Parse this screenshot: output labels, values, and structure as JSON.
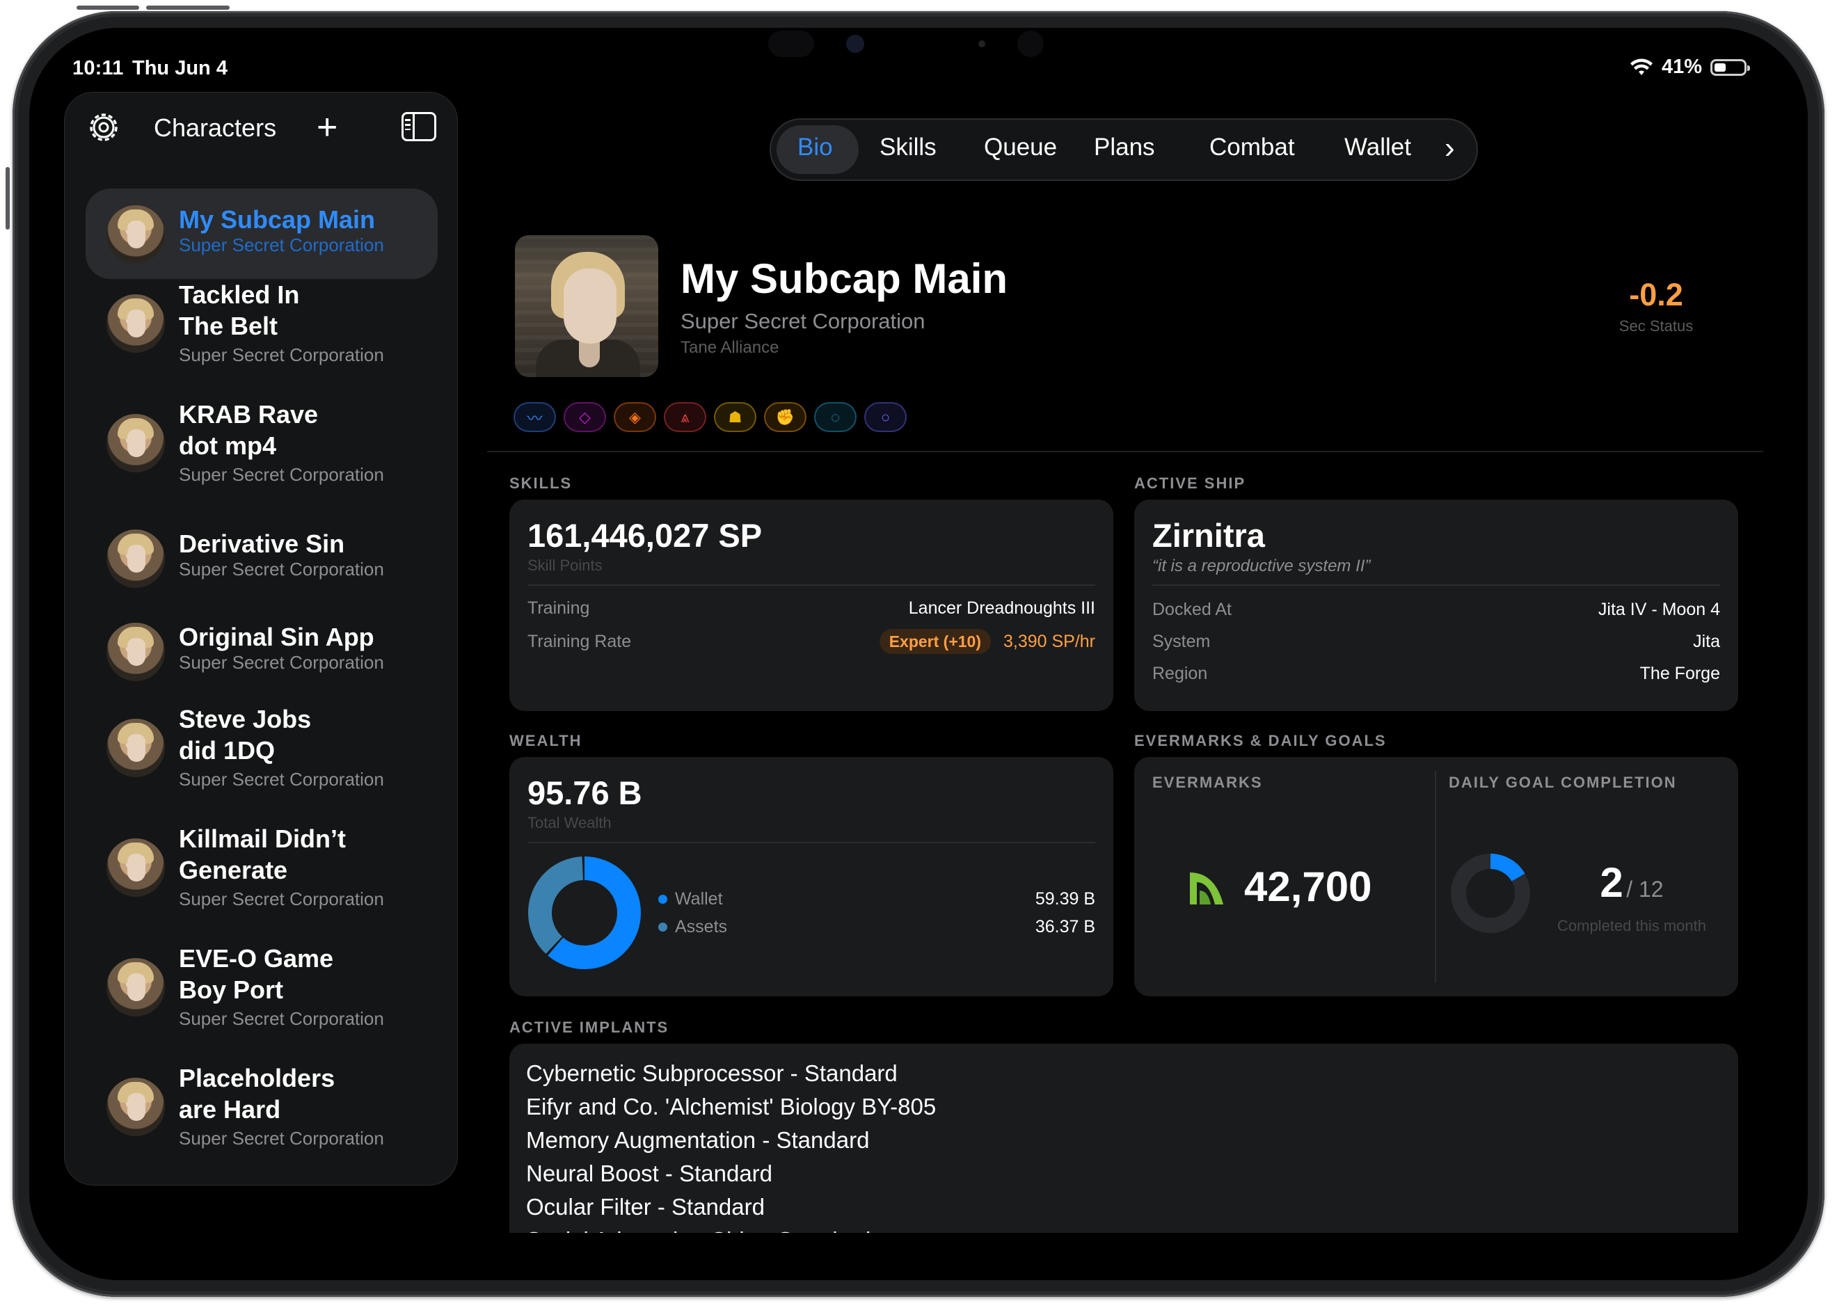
{
  "status_bar": {
    "time": "10:11",
    "date": "Thu Jun 4",
    "battery": "41%",
    "battery_level": 0.41
  },
  "sidebar": {
    "title": "Characters",
    "characters": [
      {
        "name": "My Subcap Main",
        "corp": "Super Secret Corporation",
        "selected": true
      },
      {
        "name_lines": [
          "Tackled In",
          "The Belt"
        ],
        "corp": "Super Secret Corporation"
      },
      {
        "name_lines": [
          "KRAB Rave",
          "dot mp4"
        ],
        "corp": "Super Secret Corporation"
      },
      {
        "name": "Derivative Sin",
        "corp": "Super Secret Corporation"
      },
      {
        "name": "Original Sin App",
        "corp": "Super Secret Corporation"
      },
      {
        "name_lines": [
          "Steve Jobs",
          "did 1DQ"
        ],
        "corp": "Super Secret Corporation"
      },
      {
        "name_lines": [
          "Killmail Didn’t",
          "Generate"
        ],
        "corp": "Super Secret Corporation"
      },
      {
        "name_lines": [
          "EVE-O Game",
          "Boy Port"
        ],
        "corp": "Super Secret Corporation"
      },
      {
        "name_lines": [
          "Placeholders",
          "are Hard"
        ],
        "corp": "Super Secret Corporation"
      }
    ]
  },
  "tabs": [
    "Bio",
    "Skills",
    "Queue",
    "Plans",
    "Combat",
    "Wallet"
  ],
  "active_tab": "Bio",
  "header": {
    "name": "My Subcap Main",
    "corp": "Super Secret Corporation",
    "alliance": "Tane Alliance",
    "sec_status": "-0.2",
    "sec_label": "Sec Status"
  },
  "badges": [
    {
      "icon": "route-icon",
      "glyph": "〰",
      "color": "#3b82f6"
    },
    {
      "icon": "diamond-icon",
      "glyph": "◇",
      "color": "#c026d3"
    },
    {
      "icon": "shield-chevron-icon",
      "glyph": "◈",
      "color": "#f97316"
    },
    {
      "icon": "rank-chevrons-icon",
      "glyph": "⩓",
      "color": "#ef4444"
    },
    {
      "icon": "helmet-icon",
      "glyph": "☗",
      "color": "#eab308"
    },
    {
      "icon": "fist-icon",
      "glyph": "✊",
      "color": "#f59e0b"
    },
    {
      "icon": "ring-dashed-icon",
      "glyph": "◌",
      "color": "#22a6d8"
    },
    {
      "icon": "ring-icon",
      "glyph": "○",
      "color": "#6366f1"
    }
  ],
  "skills": {
    "section": "SKILLS",
    "sp": "161,446,027 SP",
    "sp_label": "Skill Points",
    "training_label": "Training",
    "training_value": "Lancer Dreadnoughts III",
    "rate_label": "Training Rate",
    "rate_pill": "Expert (+10)",
    "rate_value": "3,390 SP/hr"
  },
  "ship": {
    "section": "ACTIVE SHIP",
    "name": "Zirnitra",
    "quote": "“it is a reproductive system II”",
    "rows": [
      {
        "k": "Docked At",
        "v": "Jita IV - Moon 4"
      },
      {
        "k": "System",
        "v": "Jita"
      },
      {
        "k": "Region",
        "v": "The Forge"
      }
    ]
  },
  "wealth": {
    "section": "WEALTH",
    "total": "95.76 B",
    "total_label": "Total Wealth",
    "items": [
      {
        "label": "Wallet",
        "value": "59.39 B",
        "amount": 59.39,
        "color": "#0a84ff"
      },
      {
        "label": "Assets",
        "value": "36.37 B",
        "amount": 36.37,
        "color": "#3b82b0"
      }
    ]
  },
  "evermarks": {
    "section": "EVERMARKS & DAILY GOALS",
    "ev_label": "EVERMARKS",
    "ev_value": "42,700",
    "goal_label": "DAILY GOAL COMPLETION",
    "completed": "2",
    "total": "/ 12",
    "completed_fraction": 0.1667,
    "caption": "Completed this month"
  },
  "implants": {
    "section": "ACTIVE IMPLANTS",
    "items": [
      "Cybernetic Subprocessor - Standard",
      "Eifyr and Co. 'Alchemist' Biology BY-805",
      "Memory Augmentation - Standard",
      "Neural Boost - Standard",
      "Ocular Filter - Standard",
      "Social Adaptation Chip - Standard"
    ]
  }
}
